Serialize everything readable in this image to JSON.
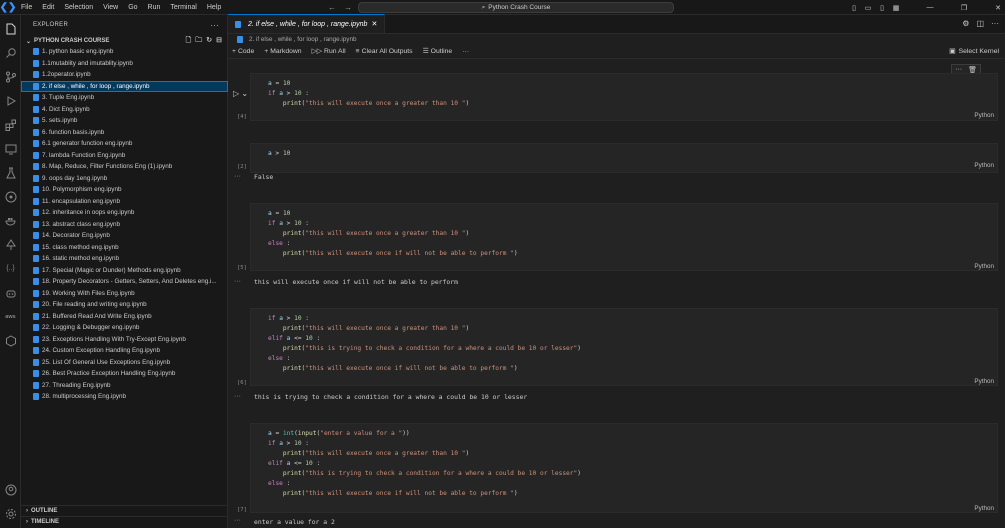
{
  "menu": [
    "File",
    "Edit",
    "Selection",
    "View",
    "Go",
    "Run",
    "Terminal",
    "Help"
  ],
  "command_center": "Python Crash Course",
  "explorer": {
    "title": "EXPLORER",
    "folder": "PYTHON CRASH COURSE",
    "files": [
      "1. python basic eng.ipynb",
      "1.1mutablity and imutablity.ipynb",
      "1.2operator.ipynb",
      "2. if else , while , for loop , range.ipynb",
      "3. Tuple Eng.ipynb",
      "4. Dict Eng.ipynb",
      "5. sets.ipynb",
      "6. function basis.ipynb",
      "6.1 generator function eng.ipynb",
      "7. lambda Function Eng.ipynb",
      "8. Map, Reduce, Filter Functions Eng (1).ipynb",
      "9. oops day 1eng.ipynb",
      "10. Polymorphism eng.ipynb",
      "11. encapsulation  eng.ipynb",
      "12. inheritance in oops eng.ipynb",
      "13. abstract class eng.ipynb",
      "14. Decorator Eng.ipynb",
      "15. class method eng.ipynb",
      "16. static method eng.ipynb",
      "17. Special (Magic or Dunder) Methods eng.ipynb",
      "18. Property Decorators - Getters, Setters, And Deletes eng.i...",
      "19. Working With Files Eng.ipynb",
      "20. File reading and writing eng.ipynb",
      "21. Buffered Read And Write Eng.ipynb",
      "22. Logging & Debugger eng.ipynb",
      "23. Exceptions Handling With Try-Except Eng.ipynb",
      "24. Custom Exception Handling Eng.ipynb",
      "25. List Of General Use Exceptions Eng.ipynb",
      "26. Best Practice Exception Handling Eng.ipynb",
      "27. Threading Eng.ipynb",
      "28. multiprocessing Eng.ipynb"
    ],
    "selected_index": 3,
    "outline": "OUTLINE",
    "timeline": "TIMELINE"
  },
  "tab": {
    "label": "2. if else , while , for loop , range.ipynb"
  },
  "breadcrumb": "2. if else , while , for loop , range.ipynb",
  "toolbar": {
    "code": "Code",
    "markdown": "Markdown",
    "run_all": "Run All",
    "clear": "Clear All Outputs",
    "outline": "Outline",
    "kernel": "Select Kernel"
  },
  "cells": [
    {
      "exec": "[4]",
      "lang": "Python"
    },
    {
      "exec": "[2]",
      "lang": "Python",
      "output": "False"
    },
    {
      "exec": "[5]",
      "lang": "Python",
      "output": "this will execute once if will not be able to perform"
    },
    {
      "exec": "[6]",
      "lang": "Python",
      "output": "this is trying to check a condition for a where a could be 10 or lesser"
    },
    {
      "exec": "[7]",
      "lang": "Python",
      "output": "enter a value for a  2"
    }
  ]
}
